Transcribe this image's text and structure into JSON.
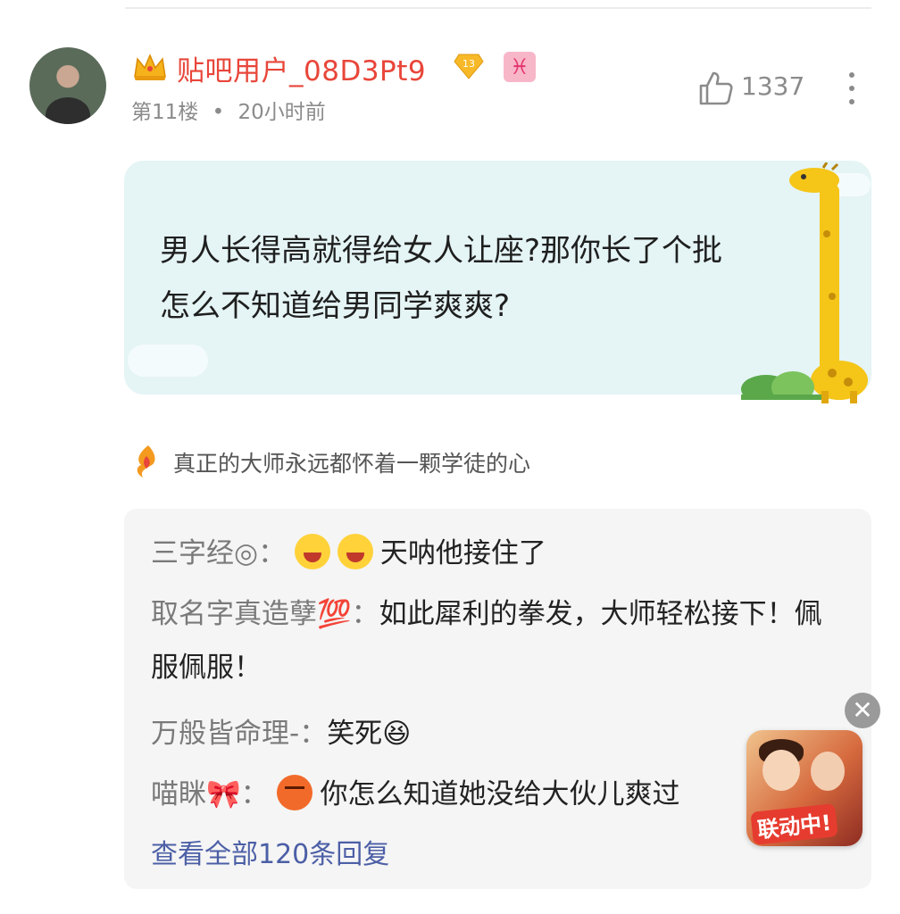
{
  "post": {
    "username": "贴吧用户_08D3Pt9",
    "level": "13",
    "zodiac_symbol": "♓",
    "floor": "第11楼",
    "separator": "•",
    "time": "20小时前",
    "likes": "1337",
    "content_line1": "男人长得高就得给女人让座?那你长了个批",
    "content_line2": "怎么不知道给男同学爽爽?",
    "signature": "真正的大师永远都怀着一颗学徒的心"
  },
  "replies": [
    {
      "author": "三字经◎",
      "sep": "：",
      "emojis": [
        "laugh",
        "laugh"
      ],
      "text": "天呐他接住了"
    },
    {
      "author": "取名字真造孽💯",
      "sep": "：",
      "emojis": [],
      "text": "如此犀利的拳发，大师轻松接下！佩服佩服！"
    },
    {
      "author": "万般皆命理-",
      "sep": "：",
      "emojis": [],
      "text": "笑死😆"
    },
    {
      "author": "喵眯🎀",
      "sep": "：",
      "emojis": [
        "angry"
      ],
      "text": "你怎么知道她没给大伙儿爽过"
    }
  ],
  "view_all": "查看全部120条回复",
  "ad": {
    "label": "联动中!",
    "close_symbol": "✕"
  },
  "colors": {
    "username": "#e8463a",
    "link": "#4c5fa6",
    "bubble": "#e5f4f5"
  },
  "icons": {
    "like": "thumbs-up-icon",
    "more": "more-vertical-icon",
    "crown": "crown-icon",
    "badge": "level-badge-icon"
  }
}
